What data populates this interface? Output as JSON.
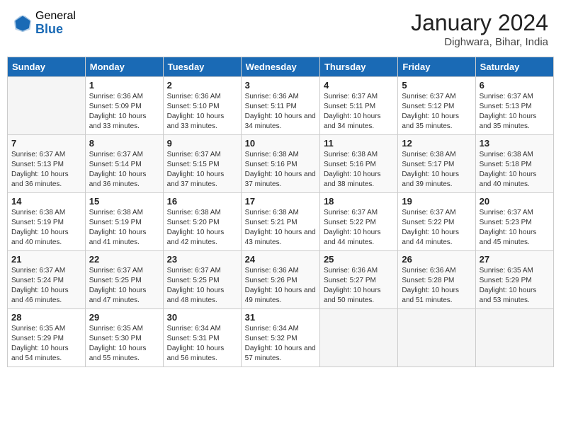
{
  "header": {
    "logo_general": "General",
    "logo_blue": "Blue",
    "month_year": "January 2024",
    "location": "Dighwara, Bihar, India"
  },
  "days_of_week": [
    "Sunday",
    "Monday",
    "Tuesday",
    "Wednesday",
    "Thursday",
    "Friday",
    "Saturday"
  ],
  "weeks": [
    [
      {
        "day": "",
        "sunrise": "",
        "sunset": "",
        "daylight": ""
      },
      {
        "day": "1",
        "sunrise": "Sunrise: 6:36 AM",
        "sunset": "Sunset: 5:09 PM",
        "daylight": "Daylight: 10 hours and 33 minutes."
      },
      {
        "day": "2",
        "sunrise": "Sunrise: 6:36 AM",
        "sunset": "Sunset: 5:10 PM",
        "daylight": "Daylight: 10 hours and 33 minutes."
      },
      {
        "day": "3",
        "sunrise": "Sunrise: 6:36 AM",
        "sunset": "Sunset: 5:11 PM",
        "daylight": "Daylight: 10 hours and 34 minutes."
      },
      {
        "day": "4",
        "sunrise": "Sunrise: 6:37 AM",
        "sunset": "Sunset: 5:11 PM",
        "daylight": "Daylight: 10 hours and 34 minutes."
      },
      {
        "day": "5",
        "sunrise": "Sunrise: 6:37 AM",
        "sunset": "Sunset: 5:12 PM",
        "daylight": "Daylight: 10 hours and 35 minutes."
      },
      {
        "day": "6",
        "sunrise": "Sunrise: 6:37 AM",
        "sunset": "Sunset: 5:13 PM",
        "daylight": "Daylight: 10 hours and 35 minutes."
      }
    ],
    [
      {
        "day": "7",
        "sunrise": "Sunrise: 6:37 AM",
        "sunset": "Sunset: 5:13 PM",
        "daylight": "Daylight: 10 hours and 36 minutes."
      },
      {
        "day": "8",
        "sunrise": "Sunrise: 6:37 AM",
        "sunset": "Sunset: 5:14 PM",
        "daylight": "Daylight: 10 hours and 36 minutes."
      },
      {
        "day": "9",
        "sunrise": "Sunrise: 6:37 AM",
        "sunset": "Sunset: 5:15 PM",
        "daylight": "Daylight: 10 hours and 37 minutes."
      },
      {
        "day": "10",
        "sunrise": "Sunrise: 6:38 AM",
        "sunset": "Sunset: 5:16 PM",
        "daylight": "Daylight: 10 hours and 37 minutes."
      },
      {
        "day": "11",
        "sunrise": "Sunrise: 6:38 AM",
        "sunset": "Sunset: 5:16 PM",
        "daylight": "Daylight: 10 hours and 38 minutes."
      },
      {
        "day": "12",
        "sunrise": "Sunrise: 6:38 AM",
        "sunset": "Sunset: 5:17 PM",
        "daylight": "Daylight: 10 hours and 39 minutes."
      },
      {
        "day": "13",
        "sunrise": "Sunrise: 6:38 AM",
        "sunset": "Sunset: 5:18 PM",
        "daylight": "Daylight: 10 hours and 40 minutes."
      }
    ],
    [
      {
        "day": "14",
        "sunrise": "Sunrise: 6:38 AM",
        "sunset": "Sunset: 5:19 PM",
        "daylight": "Daylight: 10 hours and 40 minutes."
      },
      {
        "day": "15",
        "sunrise": "Sunrise: 6:38 AM",
        "sunset": "Sunset: 5:19 PM",
        "daylight": "Daylight: 10 hours and 41 minutes."
      },
      {
        "day": "16",
        "sunrise": "Sunrise: 6:38 AM",
        "sunset": "Sunset: 5:20 PM",
        "daylight": "Daylight: 10 hours and 42 minutes."
      },
      {
        "day": "17",
        "sunrise": "Sunrise: 6:38 AM",
        "sunset": "Sunset: 5:21 PM",
        "daylight": "Daylight: 10 hours and 43 minutes."
      },
      {
        "day": "18",
        "sunrise": "Sunrise: 6:37 AM",
        "sunset": "Sunset: 5:22 PM",
        "daylight": "Daylight: 10 hours and 44 minutes."
      },
      {
        "day": "19",
        "sunrise": "Sunrise: 6:37 AM",
        "sunset": "Sunset: 5:22 PM",
        "daylight": "Daylight: 10 hours and 44 minutes."
      },
      {
        "day": "20",
        "sunrise": "Sunrise: 6:37 AM",
        "sunset": "Sunset: 5:23 PM",
        "daylight": "Daylight: 10 hours and 45 minutes."
      }
    ],
    [
      {
        "day": "21",
        "sunrise": "Sunrise: 6:37 AM",
        "sunset": "Sunset: 5:24 PM",
        "daylight": "Daylight: 10 hours and 46 minutes."
      },
      {
        "day": "22",
        "sunrise": "Sunrise: 6:37 AM",
        "sunset": "Sunset: 5:25 PM",
        "daylight": "Daylight: 10 hours and 47 minutes."
      },
      {
        "day": "23",
        "sunrise": "Sunrise: 6:37 AM",
        "sunset": "Sunset: 5:25 PM",
        "daylight": "Daylight: 10 hours and 48 minutes."
      },
      {
        "day": "24",
        "sunrise": "Sunrise: 6:36 AM",
        "sunset": "Sunset: 5:26 PM",
        "daylight": "Daylight: 10 hours and 49 minutes."
      },
      {
        "day": "25",
        "sunrise": "Sunrise: 6:36 AM",
        "sunset": "Sunset: 5:27 PM",
        "daylight": "Daylight: 10 hours and 50 minutes."
      },
      {
        "day": "26",
        "sunrise": "Sunrise: 6:36 AM",
        "sunset": "Sunset: 5:28 PM",
        "daylight": "Daylight: 10 hours and 51 minutes."
      },
      {
        "day": "27",
        "sunrise": "Sunrise: 6:35 AM",
        "sunset": "Sunset: 5:29 PM",
        "daylight": "Daylight: 10 hours and 53 minutes."
      }
    ],
    [
      {
        "day": "28",
        "sunrise": "Sunrise: 6:35 AM",
        "sunset": "Sunset: 5:29 PM",
        "daylight": "Daylight: 10 hours and 54 minutes."
      },
      {
        "day": "29",
        "sunrise": "Sunrise: 6:35 AM",
        "sunset": "Sunset: 5:30 PM",
        "daylight": "Daylight: 10 hours and 55 minutes."
      },
      {
        "day": "30",
        "sunrise": "Sunrise: 6:34 AM",
        "sunset": "Sunset: 5:31 PM",
        "daylight": "Daylight: 10 hours and 56 minutes."
      },
      {
        "day": "31",
        "sunrise": "Sunrise: 6:34 AM",
        "sunset": "Sunset: 5:32 PM",
        "daylight": "Daylight: 10 hours and 57 minutes."
      },
      {
        "day": "",
        "sunrise": "",
        "sunset": "",
        "daylight": ""
      },
      {
        "day": "",
        "sunrise": "",
        "sunset": "",
        "daylight": ""
      },
      {
        "day": "",
        "sunrise": "",
        "sunset": "",
        "daylight": ""
      }
    ]
  ]
}
